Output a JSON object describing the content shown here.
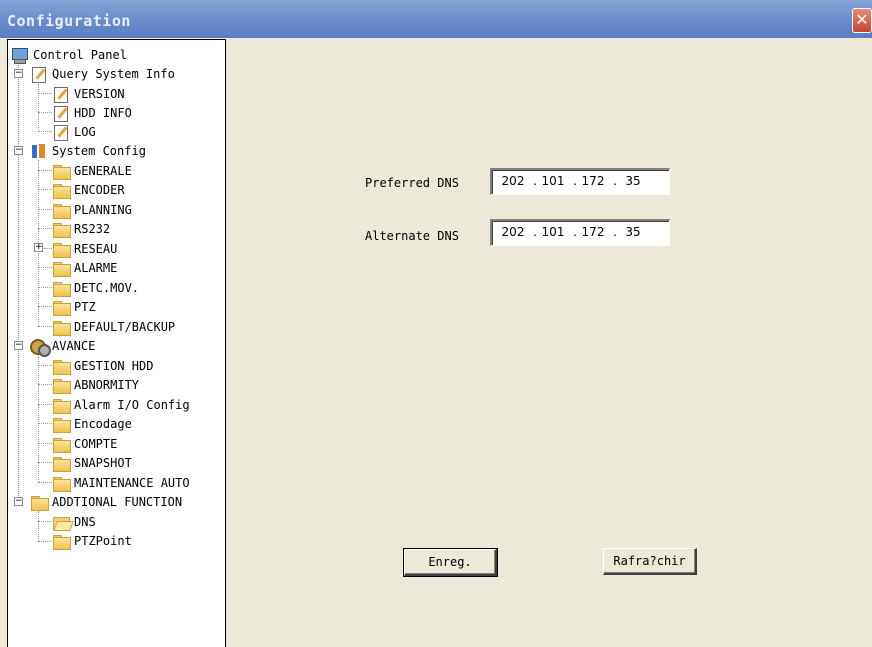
{
  "window": {
    "title": "Configuration",
    "close_glyph": "✕"
  },
  "tree": {
    "root": "Control Panel",
    "groups": [
      {
        "label": "Query System Info",
        "expanded": true,
        "items": [
          "VERSION",
          "HDD INFO",
          "LOG"
        ]
      },
      {
        "label": "System Config",
        "expanded": true,
        "items": [
          "GENERALE",
          "ENCODER",
          "PLANNING",
          "RS232",
          "RESEAU",
          "ALARME",
          "DETC.MOV.",
          "PTZ",
          "DEFAULT/BACKUP"
        ]
      },
      {
        "label": "AVANCE",
        "expanded": true,
        "items": [
          "GESTION HDD",
          "ABNORMITY",
          "Alarm I/O Config",
          "Encodage",
          "COMPTE",
          "SNAPSHOT",
          "MAINTENANCE AUTO"
        ]
      },
      {
        "label": "ADDTIONAL FUNCTION",
        "expanded": true,
        "items": [
          "DNS",
          "PTZPoint"
        ]
      }
    ],
    "selected": "DNS",
    "expand_minus": "−",
    "expand_plus": "+"
  },
  "dns": {
    "preferred_label": "Preferred DNS",
    "preferred_ip": [
      "202",
      "101",
      "172",
      "35"
    ],
    "alternate_label": "Alternate DNS",
    "alternate_ip": [
      "202",
      "101",
      "172",
      "35"
    ],
    "separator": "."
  },
  "buttons": {
    "save_label": "Enreg.",
    "refresh_label": "Rafra?chir"
  },
  "colors": {
    "titlebar": "#6f8fcf",
    "panel_bg": "#ece9d8",
    "close_button": "#c8452f"
  }
}
